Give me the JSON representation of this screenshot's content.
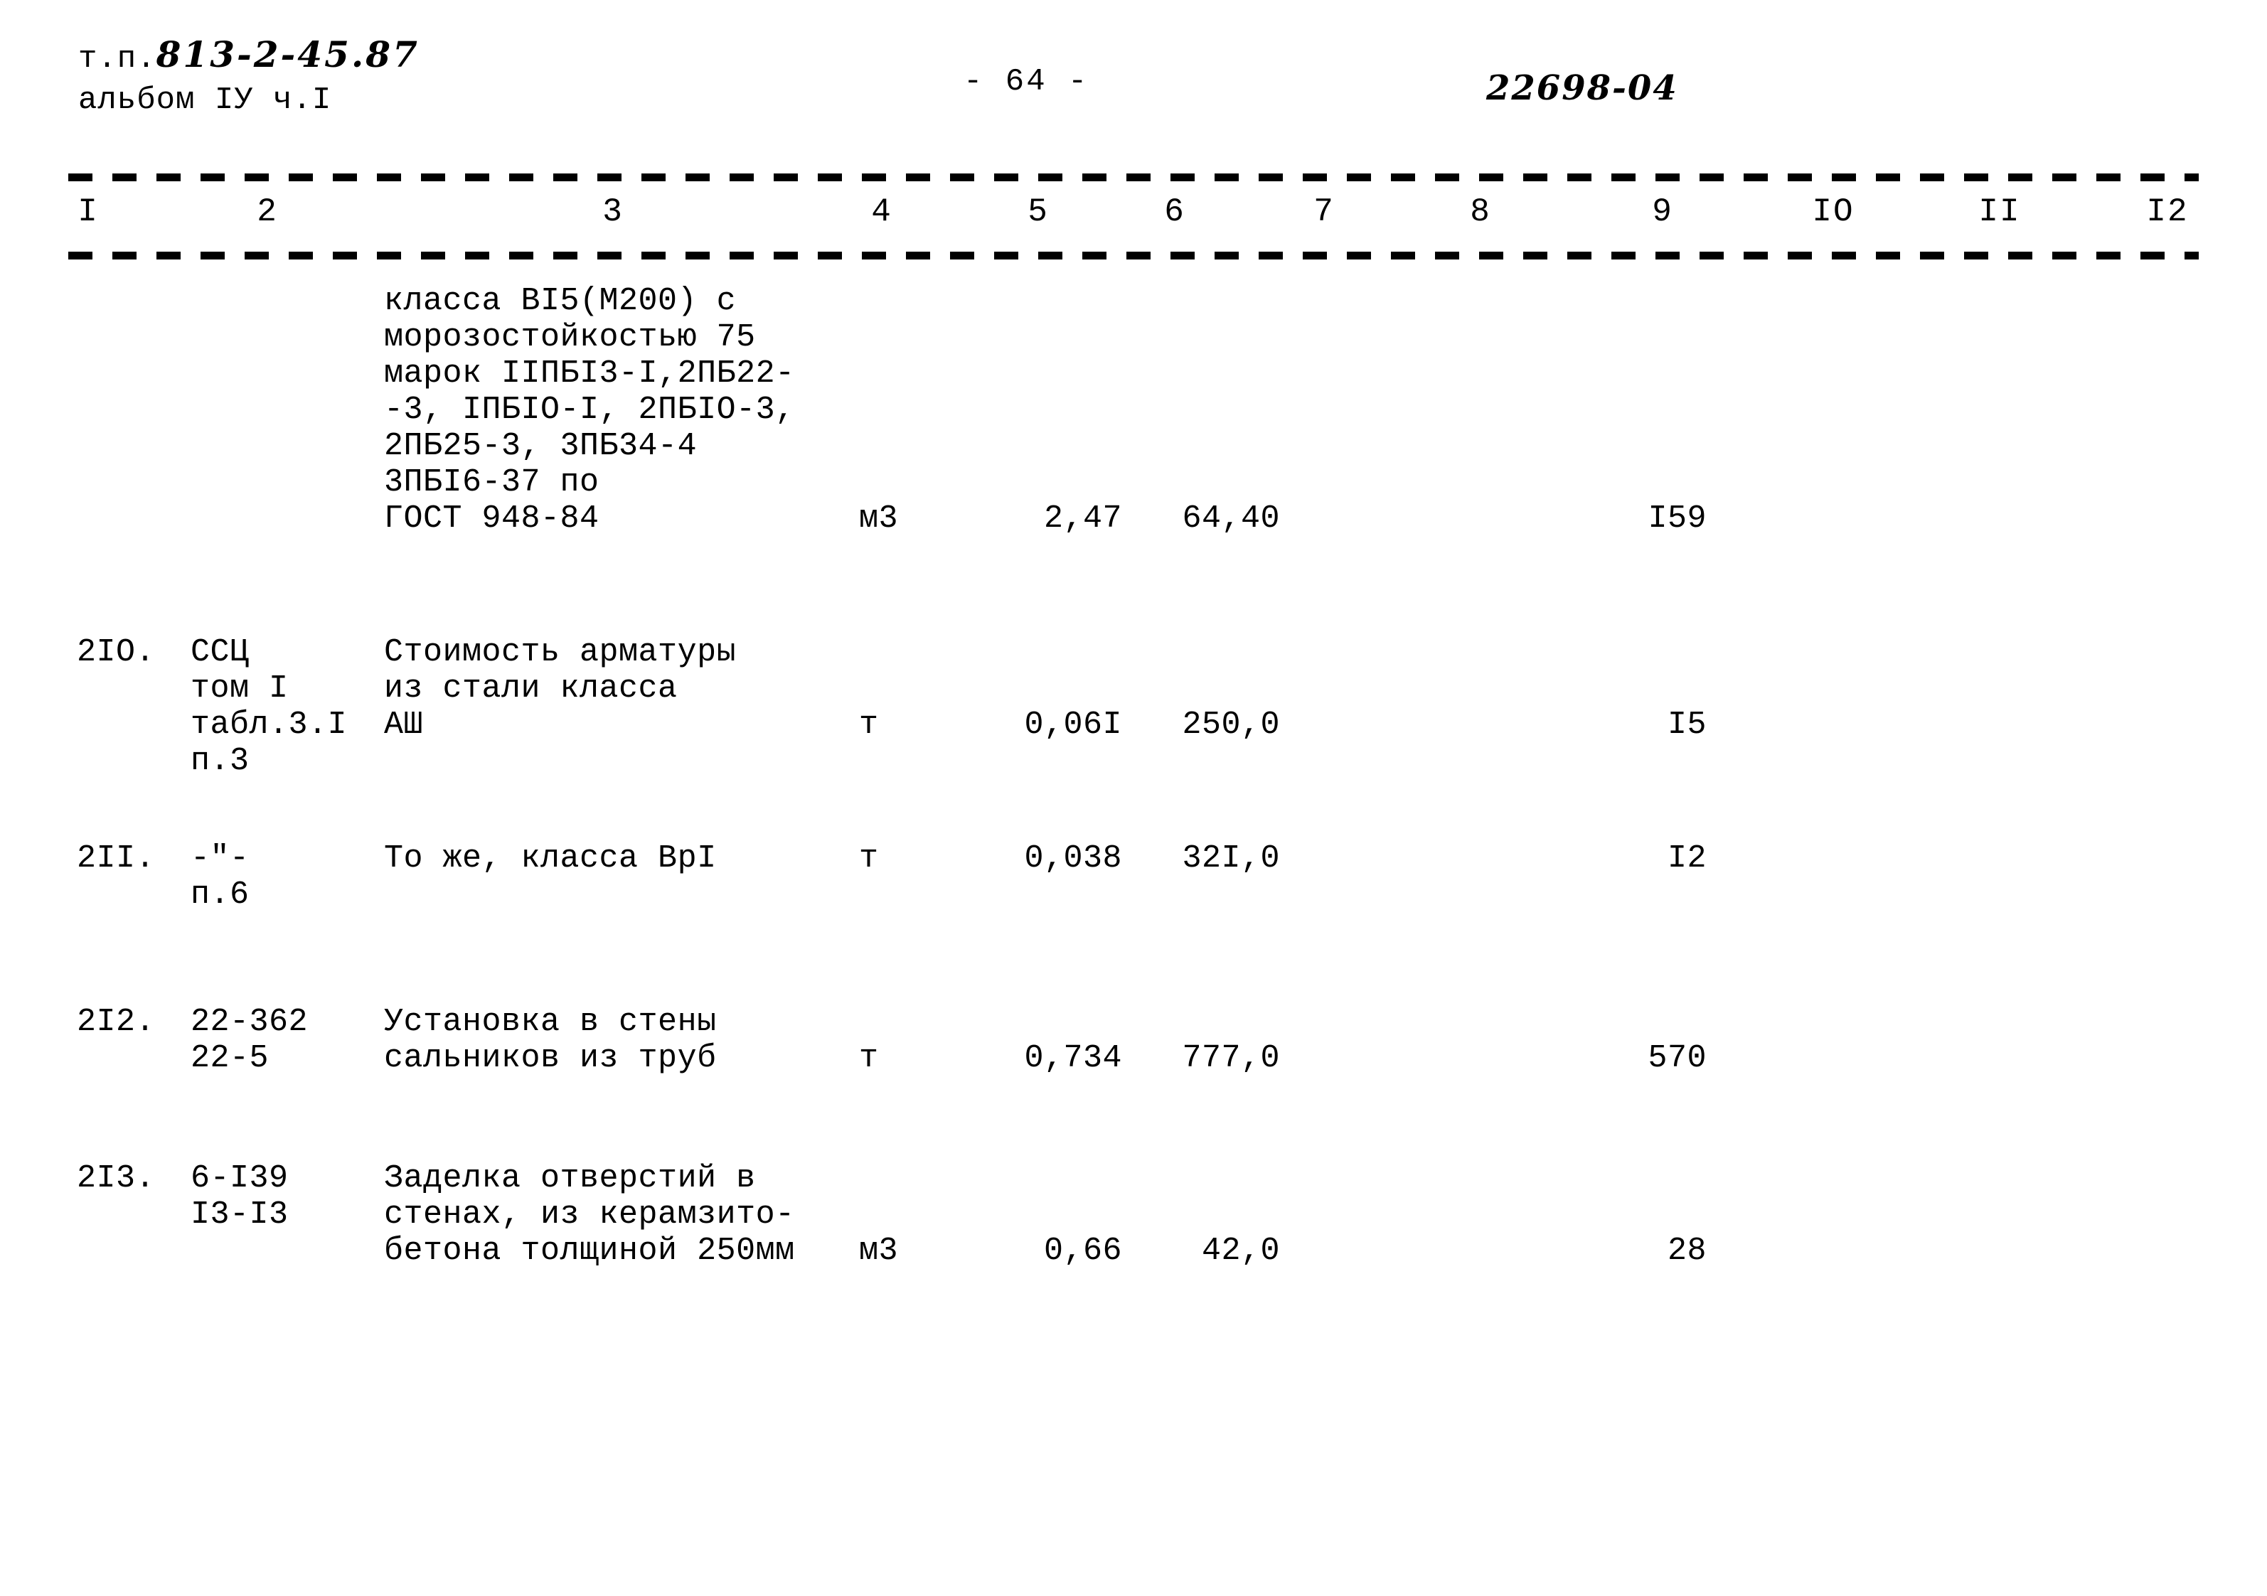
{
  "header": {
    "doc_prefix": "т.п.",
    "doc_number": "813-2-45.87",
    "album_line": "альбом IУ ч.I",
    "page_number": "- 64 -",
    "doc_code": "22698-04"
  },
  "table": {
    "column_numbers": [
      "I",
      "2",
      "3",
      "4",
      "5",
      "6",
      "7",
      "8",
      "9",
      "IO",
      "II",
      "I2"
    ],
    "rows": [
      {
        "num": "",
        "code": "",
        "desc": "класса ВI5(М200) с\nморозостойкостью 75\nмарок IIПБI3-I,2ПБ22-\n-3, IПБIO-I, 2ПБIO-3,\n2ПБ25-3, 3ПБ34-4\n3ПБI6-37 по\nГОСТ 948-84",
        "unit": "м3",
        "qty": "2,47",
        "price": "64,40",
        "total": "I59"
      },
      {
        "num": "2IO.",
        "code": "ССЦ\nтом I\nтабл.3.I\nп.3",
        "desc": "Стоимость арматуры\nиз стали класса\nАШ",
        "unit": "т",
        "qty": "0,06I",
        "price": "250,0",
        "total": "I5"
      },
      {
        "num": "2II.",
        "code": "-\"-\nп.6",
        "desc": "То же, класса ВрI",
        "unit": "т",
        "qty": "0,038",
        "price": "32I,0",
        "total": "I2"
      },
      {
        "num": "2I2.",
        "code": "22-362\n22-5",
        "desc": "Установка в стены\nсальников из труб",
        "unit": "т",
        "qty": "0,734",
        "price": "777,0",
        "total": "570"
      },
      {
        "num": "2I3.",
        "code": "6-I39\nI3-I3",
        "desc": "Заделка отверстий в\nстенах, из керамзито-\nбетона толщиной 250мм",
        "unit": "м3",
        "qty": "0,66",
        "price": "42,0",
        "total": "28"
      }
    ]
  }
}
